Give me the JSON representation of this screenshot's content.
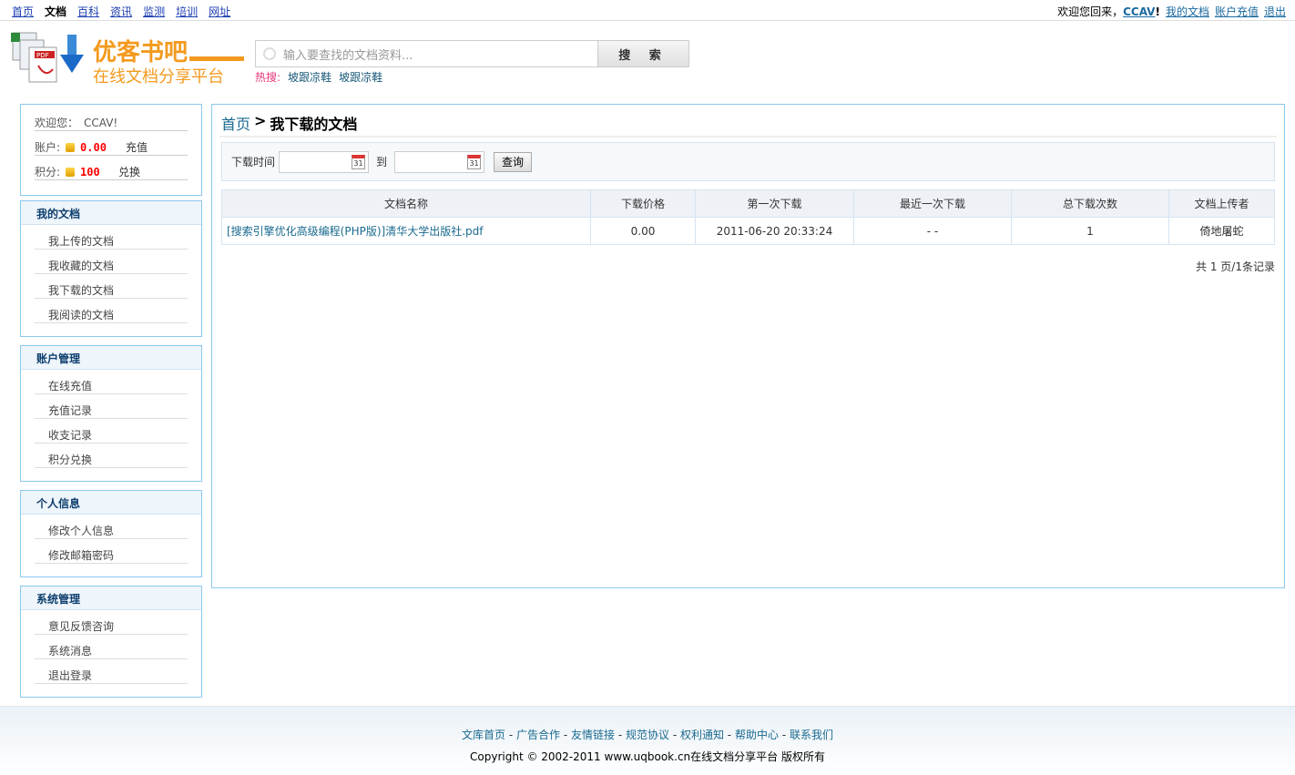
{
  "topnav": {
    "items": [
      "首页",
      "文档",
      "百科",
      "资讯",
      "监测",
      "培训",
      "网址"
    ],
    "current": 1
  },
  "topright": {
    "welcome": "欢迎您回来，",
    "user": "CCAV",
    "excl": "!",
    "links": [
      "我的文档",
      "账户充值",
      "退出"
    ]
  },
  "logo": {
    "title": "优客书吧",
    "subtitle": "在线文档分享平台"
  },
  "search": {
    "placeholder": "输入要查找的文档资料...",
    "button": "搜 索",
    "hot_label": "热搜:",
    "hot": [
      "坡跟凉鞋",
      "坡跟凉鞋"
    ]
  },
  "userinfo": {
    "welcome": "欢迎您：",
    "user": "CCAV!",
    "account_label": "账户:",
    "account_value": "0.00",
    "recharge": "充值",
    "points_label": "积分:",
    "points_value": "100",
    "exchange": "兑换"
  },
  "sidebar": [
    {
      "title": "我的文档",
      "items": [
        "我上传的文档",
        "我收藏的文档",
        "我下载的文档",
        "我阅读的文档"
      ]
    },
    {
      "title": "账户管理",
      "items": [
        "在线充值",
        "充值记录",
        "收支记录",
        "积分兑换"
      ]
    },
    {
      "title": "个人信息",
      "items": [
        "修改个人信息",
        "修改邮箱密码"
      ]
    },
    {
      "title": "系统管理",
      "items": [
        "意见反馈咨询",
        "系统消息",
        "退出登录"
      ]
    }
  ],
  "main": {
    "crumb_home": "首页",
    "crumb_sep": ">",
    "crumb_current": "我下载的文档",
    "filter": {
      "label": "下载时间",
      "to": "到",
      "from_value": "",
      "to_value": "",
      "query": "查询"
    },
    "columns": [
      "文档名称",
      "下载价格",
      "第一次下载",
      "最近一次下载",
      "总下载次数",
      "文档上传者"
    ],
    "rows": [
      [
        "[搜索引擎优化高级编程(PHP版)]清华大学出版社.pdf",
        "0.00",
        "2011-06-20 20:33:24",
        "- -",
        "1",
        "倚地屠蛇"
      ]
    ],
    "pager": "共 1 页/1条记录"
  },
  "footer": {
    "links": [
      "文库首页",
      "广告合作",
      "友情链接",
      "规范协议",
      "权利通知",
      "帮助中心",
      "联系我们"
    ],
    "copyright": "Copyright © 2002-2011 www.uqbook.cn在线文档分享平台 版权所有"
  }
}
